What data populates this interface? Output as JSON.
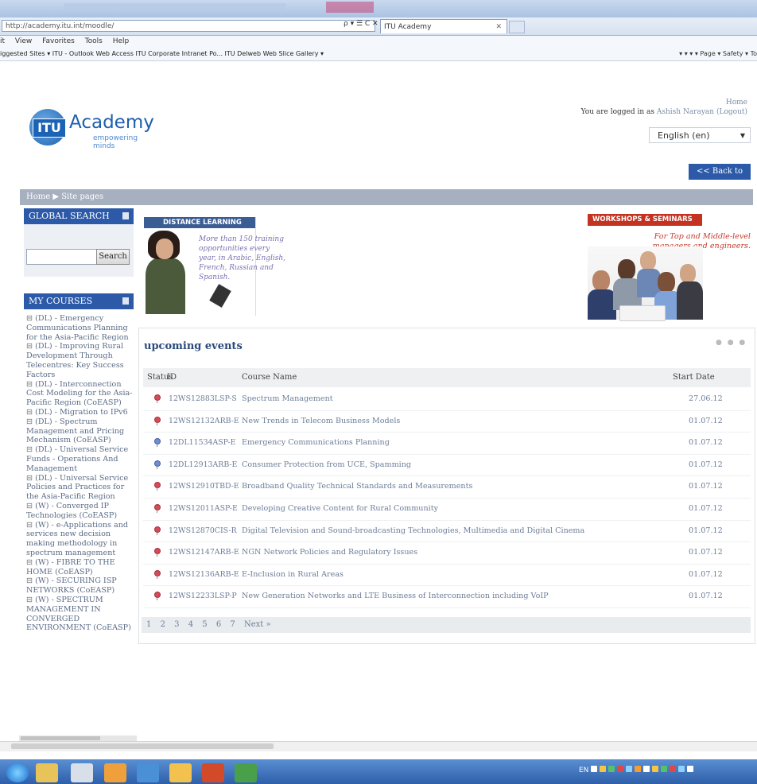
{
  "browser": {
    "address": "http://academy.itu.int/moodle/",
    "address_domain": "itu.int",
    "address_ctrls": "ρ ▾ ☰ C ✕",
    "tab_title": "ITU Academy",
    "tab_close": "✕",
    "menu": [
      "it",
      "View",
      "Favorites",
      "Tools",
      "Help"
    ],
    "favorites": "iggested Sites ▾   ITU - Outlook Web Access   ITU Corporate Intranet Po...   ITU Delweb   Web Slice Gallery ▾",
    "tools_right": "▾  ▾  ▾   ▾ Page ▾  Safety ▾  To"
  },
  "header": {
    "logo_itu": "ITU",
    "logo_name": "Academy",
    "logo_tagline": "empowering minds",
    "home_link": "Home",
    "login_prefix": "You are logged in as ",
    "login_user": "Ashish Narayan",
    "logout": "(Logout)",
    "language": "English (en)",
    "back_button": "<< Back to Home"
  },
  "breadcrumb": "Home ▶ Site pages",
  "global_search": {
    "title": "GLOBAL SEARCH",
    "button": "Search",
    "value": ""
  },
  "my_courses": {
    "title": "MY COURSES",
    "items": [
      "(DL) - Emergency Communications Planning for the Asia-Pacific Region",
      "(DL) - Improving Rural Development Through Telecentres: Key Success Factors",
      "(DL) - Interconnection Cost Modeling for the Asia-Pacific Region (CoEASP)",
      "(DL) - Migration to IPv6",
      "(DL) - Spectrum Management and Pricing Mechanism (CoEASP)",
      "(DL) - Universal Service Funds - Operations And Management",
      "(DL) - Universal Service Policies and Practices for the Asia-Pacific Region",
      "(W) - Converged IP Technologies (CoEASP)",
      "(W) - e-Applications and services new decision making methodology in spectrum management",
      "(W) - FIBRE TO THE HOME (CoEASP)",
      "(W) - SECURING ISP NETWORKS (CoEASP)",
      "(W) - SPECTRUM MANAGEMENT IN CONVERGED ENVIRONMENT (CoEASP)"
    ]
  },
  "promo_distance": {
    "title": "DISTANCE LEARNING",
    "text": "More than 150 training opportunities every year, in Arabic, English, French, Russian and Spanish."
  },
  "promo_workshops": {
    "title": "WORKSHOPS & SEMINARS",
    "text": "For Top and Middle-level managers and engineers."
  },
  "events": {
    "title": "upcoming events",
    "dots": "● ● ●",
    "columns": {
      "status": "Status",
      "id": "ID",
      "name": "Course Name",
      "date": "Start Date"
    },
    "rows": [
      {
        "id": "12WS12883LSP-S",
        "name": "Spectrum Management",
        "date": "27.06.12",
        "pin": "red"
      },
      {
        "id": "12WS12132ARB-E",
        "name": "New Trends in Telecom Business Models",
        "date": "01.07.12",
        "pin": "red"
      },
      {
        "id": "12DL11534ASP-E",
        "name": "Emergency Communications Planning",
        "date": "01.07.12",
        "pin": "blue"
      },
      {
        "id": "12DL12913ARB-E",
        "name": "Consumer Protection from UCE, Spamming",
        "date": "01.07.12",
        "pin": "blue"
      },
      {
        "id": "12WS12910TBD-E",
        "name": "Broadband Quality Technical Standards and Measurements",
        "date": "01.07.12",
        "pin": "red"
      },
      {
        "id": "12WS12011ASP-E",
        "name": "Developing Creative Content for Rural Community",
        "date": "01.07.12",
        "pin": "red"
      },
      {
        "id": "12WS12870CIS-R",
        "name": "Digital Television and Sound-broadcasting Technologies, Multimedia and Digital Cinema",
        "date": "01.07.12",
        "pin": "red"
      },
      {
        "id": "12WS12147ARB-E",
        "name": "NGN Network Policies and Regulatory Issues",
        "date": "01.07.12",
        "pin": "red"
      },
      {
        "id": "12WS12136ARB-E",
        "name": "E-Inclusion in Rural Areas",
        "date": "01.07.12",
        "pin": "red"
      },
      {
        "id": "12WS12233LSP-P",
        "name": "New Generation Networks and LTE Business of Interconnection including VoIP",
        "date": "01.07.12",
        "pin": "red"
      }
    ],
    "pages": [
      "1",
      "2",
      "3",
      "4",
      "5",
      "6",
      "7"
    ],
    "next": "Next »"
  },
  "taskbar": {
    "tray_lang": "EN"
  }
}
